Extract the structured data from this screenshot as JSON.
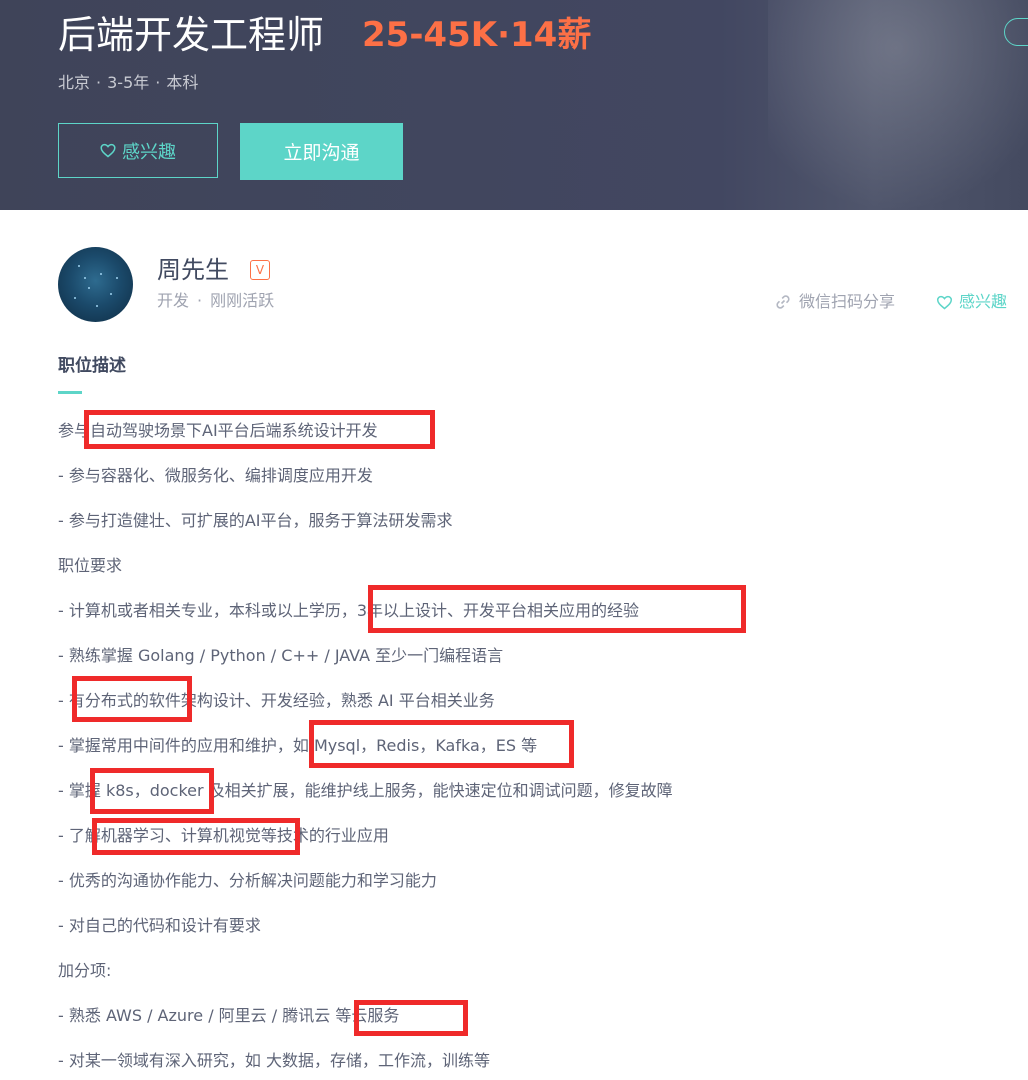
{
  "job": {
    "title": "后端开发工程师",
    "salary": "25-45K·14薪",
    "city": "北京",
    "experience": "3-5年",
    "education": "本科",
    "sep": "·"
  },
  "actions": {
    "interest_label": "感兴趣",
    "chat_label": "立即沟通"
  },
  "recruiter": {
    "name": "周先生",
    "badge": "V",
    "role": "开发",
    "sep": "·",
    "status": "刚刚活跃",
    "share_label": "微信扫码分享",
    "interest_label": "感兴趣"
  },
  "description": {
    "title": "职位描述",
    "lines": [
      "参与自动驾驶场景下AI平台后端系统设计开发",
      "- 参与容器化、微服务化、编排调度应用开发",
      "- 参与打造健壮、可扩展的AI平台，服务于算法研发需求",
      "职位要求",
      "- 计算机或者相关专业，本科或以上学历，3年以上设计、开发平台相关应用的经验",
      "- 熟练掌握 Golang / Python / C++ / JAVA 至少一门编程语言",
      "- 有分布式的软件架构设计、开发经验，熟悉 AI 平台相关业务",
      "- 掌握常用中间件的应用和维护，如 Mysql，Redis，Kafka，ES 等",
      "- 掌握 k8s，docker 及相关扩展，能维护线上服务，能快速定位和调试问题，修复故障",
      "- 了解机器学习、计算机视觉等技术的行业应用",
      "- 优秀的沟通协作能力、分析解决问题能力和学习能力",
      "- 对自己的代码和设计有要求",
      "加分项:",
      "- 熟悉 AWS / Azure / 阿里云 / 腾讯云 等云服务",
      "- 对某一领域有深入研究，如 大数据，存储，工作流，训练等"
    ]
  },
  "colors": {
    "header_bg": "#424761",
    "accent": "#5dd5c8",
    "salary": "#fd7046",
    "highlight": "#ef2a2a"
  }
}
